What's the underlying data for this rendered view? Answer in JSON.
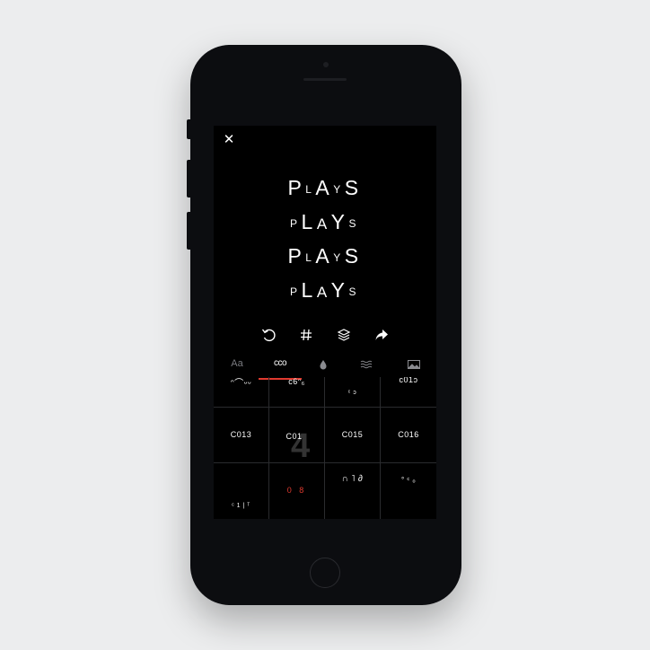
{
  "poster": {
    "lines": [
      [
        "P",
        "L",
        "A",
        "Y",
        "S"
      ],
      [
        "P",
        "L",
        "A",
        "Y",
        "S"
      ],
      [
        "P",
        "L",
        "A",
        "Y",
        "S"
      ],
      [
        "P",
        "L",
        "A",
        "Y",
        "S"
      ]
    ]
  },
  "actions": {
    "undo": "undo-icon",
    "grid": "hash-grid-icon",
    "layers": "layers-icon",
    "share": "share-icon"
  },
  "tabs": {
    "font": "Aa",
    "style": "ϲϲo",
    "color": "drop-icon",
    "texture": "waves-icon",
    "image": "image-icon",
    "active_color": "#e03a2f"
  },
  "grid": {
    "row0": [
      "ᵔ⌒ᵕᵕ",
      "c6ᵔ₆",
      "ᶜ ɔ",
      "c01ɔ"
    ],
    "row1": [
      "C013",
      "C01",
      "C015",
      "C016"
    ],
    "row1_ghost": "4",
    "row2": [
      "ᶜ  1  | ᵀ",
      "0 8",
      "∩   ˥   ∂",
      "° ᶜ ₒ"
    ]
  }
}
